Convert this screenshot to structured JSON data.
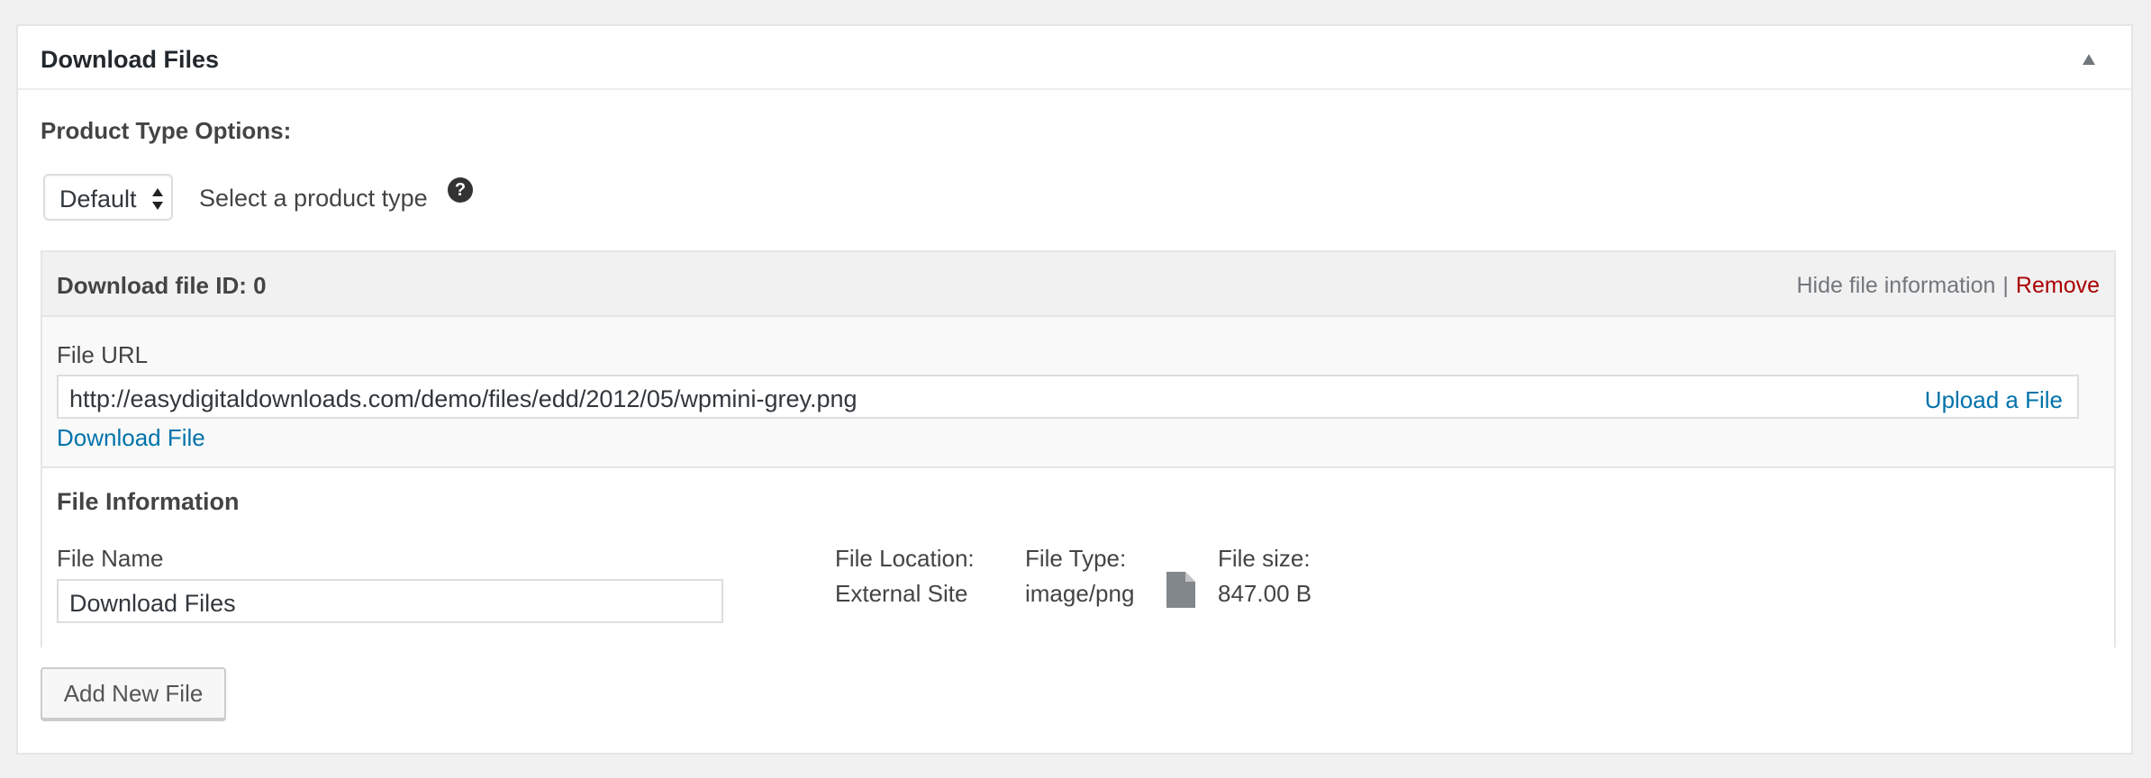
{
  "panel": {
    "title": "Download Files",
    "toggle_icon": "triangle-up-icon"
  },
  "product_type": {
    "label": "Product Type Options:",
    "selected": "Default",
    "hint": "Select a product type",
    "help_icon": "question-circle-icon",
    "help_glyph": "?"
  },
  "file": {
    "id_title": "Download file ID: 0",
    "hide_label": "Hide file information",
    "separator": "|",
    "remove_label": "Remove",
    "url_label": "File URL",
    "url_value": "http://easydigitaldownloads.com/demo/files/edd/2012/05/wpmini-grey.png",
    "upload_label": "Upload a File",
    "download_label": "Download File",
    "info": {
      "heading": "File Information",
      "name_label": "File Name",
      "name_value": "Download Files",
      "location_label": "File Location:",
      "location_value": "External Site",
      "type_label": "File Type:",
      "type_value": "image/png",
      "type_icon": "document-icon",
      "size_label": "File size:",
      "size_value": "847.00 B"
    }
  },
  "add_button_label": "Add New File",
  "colors": {
    "link": "#0073aa",
    "remove": "#aa0000",
    "page_bg": "#f1f1f1"
  }
}
